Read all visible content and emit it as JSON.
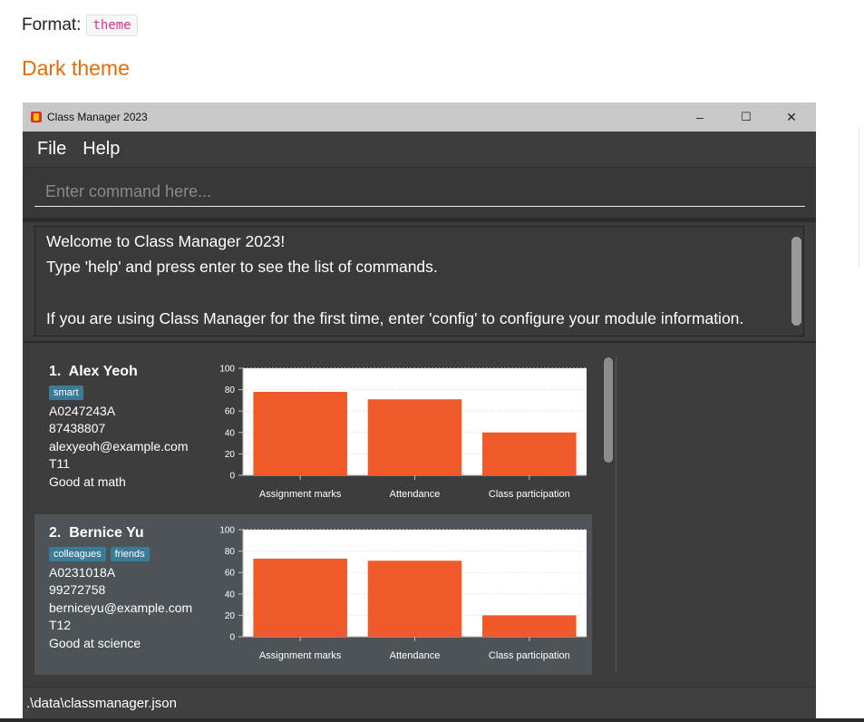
{
  "doc": {
    "format_label": "Format:",
    "format_code": "theme",
    "heading": "Dark theme"
  },
  "window": {
    "title": "Class Manager 2023",
    "controls": {
      "minimize": "–",
      "maximize": "☐",
      "close": "✕"
    }
  },
  "menu": {
    "items": [
      "File",
      "Help"
    ]
  },
  "command": {
    "placeholder": "Enter command here...",
    "value": ""
  },
  "result": {
    "lines": [
      "Welcome to Class Manager 2023!",
      "Type 'help' and press enter to see the list of commands.",
      "",
      "If you are using Class Manager for the first time, enter 'config' to configure your module information."
    ]
  },
  "students": [
    {
      "index": "1.",
      "name": "Alex Yeoh",
      "tags": [
        "smart"
      ],
      "student_number": "A0247243A",
      "phone": "87438807",
      "email": "alexyeoh@example.com",
      "class": "T11",
      "comment": "Good at math"
    },
    {
      "index": "2.",
      "name": "Bernice Yu",
      "tags": [
        "colleagues",
        "friends"
      ],
      "student_number": "A0231018A",
      "phone": "99272758",
      "email": "berniceyu@example.com",
      "class": "T12",
      "comment": "Good at science"
    }
  ],
  "chart_data": [
    {
      "type": "bar",
      "categories": [
        "Assignment marks",
        "Attendance",
        "Class participation"
      ],
      "values": [
        78,
        71,
        40
      ],
      "ylim": [
        0,
        100
      ],
      "yticks": [
        0,
        20,
        40,
        60,
        80,
        100
      ],
      "bar_color": "#f05a28",
      "grid": true
    },
    {
      "type": "bar",
      "categories": [
        "Assignment marks",
        "Attendance",
        "Class participation"
      ],
      "values": [
        73,
        71,
        20
      ],
      "ylim": [
        0,
        100
      ],
      "yticks": [
        0,
        20,
        40,
        60,
        80,
        100
      ],
      "bar_color": "#f05a28",
      "grid": true
    }
  ],
  "status": {
    "file_path": ".\\data\\classmanager.json"
  },
  "colors": {
    "heading": "#e46c0a",
    "window_bg": "#3c3c3c",
    "tag_bg": "#3a7b96",
    "bar": "#f05a28"
  }
}
